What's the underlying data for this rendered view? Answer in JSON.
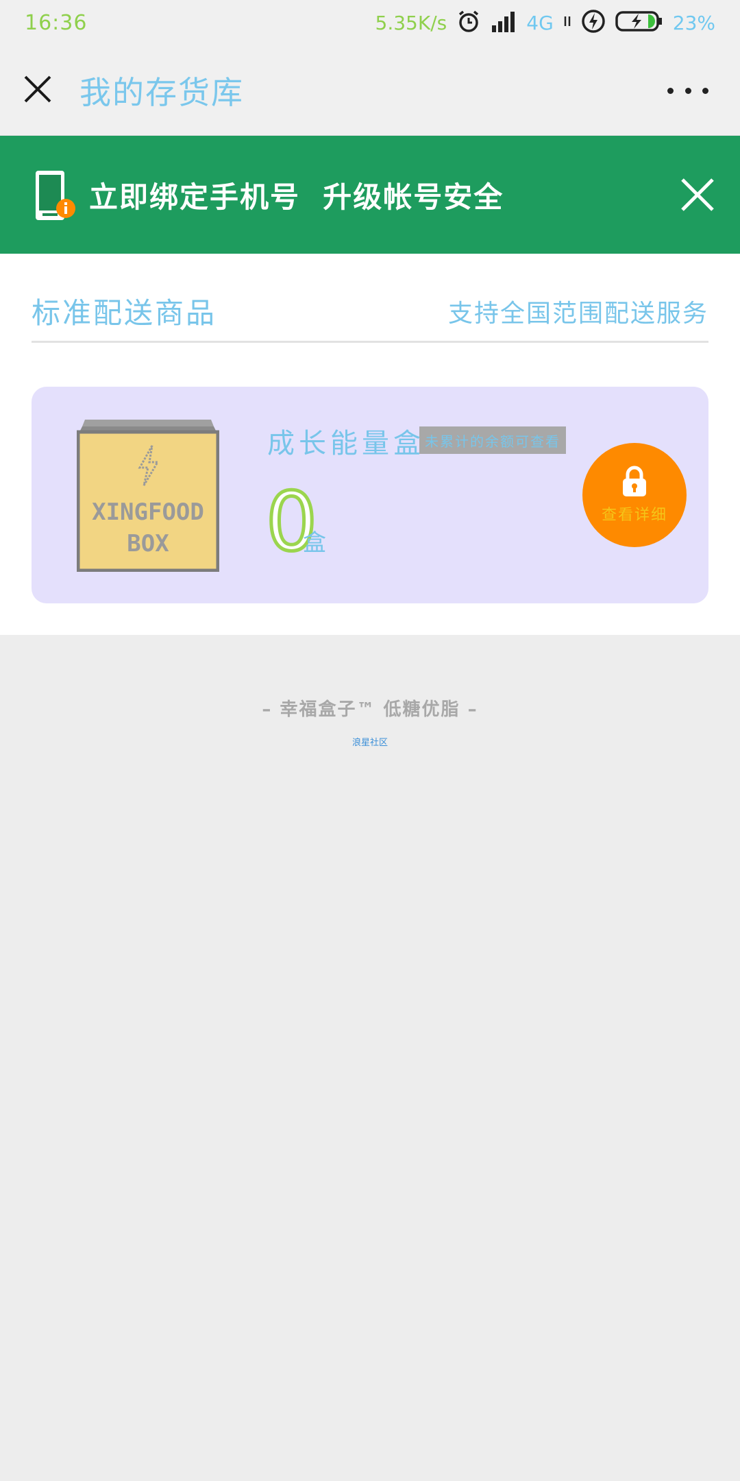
{
  "status_bar": {
    "time": "16:36",
    "speed": "5.35K/s",
    "network": "4G",
    "battery": "23%"
  },
  "title_bar": {
    "title": "我的存货库",
    "close_icon": "close-icon",
    "more_icon": "more-icon"
  },
  "banner": {
    "text": "立即绑定手机号  升级帐号安全",
    "bg_color": "#1e9c5e"
  },
  "section": {
    "left_title": "标准配送商品",
    "right_note": "支持全国范围配送服务"
  },
  "card": {
    "illustration_text_1": "XINGFOOD",
    "illustration_text_2": "BOX",
    "title": "成长能量盒",
    "badge": "未累计的余额可查看",
    "count": "0",
    "unit": "盒",
    "detail_button": "查看详细",
    "bg_color": "#e4e0fc",
    "button_color": "#fe8a00"
  },
  "footer": {
    "brand": "– 幸福盒子™ 低糖优脂 –",
    "link": "浪星社区"
  }
}
